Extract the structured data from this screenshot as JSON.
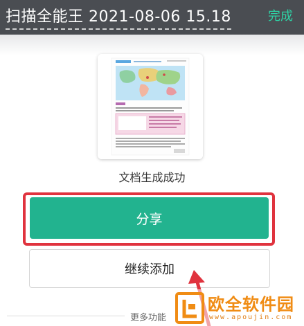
{
  "header": {
    "title": "扫描全能王 2021-08-06 15.18",
    "done_label": "完成"
  },
  "document": {
    "status": "文档生成成功"
  },
  "actions": {
    "share_label": "分享",
    "continue_label": "继续添加",
    "more_label": "更多功能"
  },
  "watermark": {
    "name": "欧全软件园",
    "url": "www.apoujin.com"
  },
  "colors": {
    "header_bg": "#4a4d52",
    "accent": "#22b38f",
    "done_text": "#2ed3a5",
    "highlight": "#e0333e",
    "watermark": "#f08c14"
  }
}
